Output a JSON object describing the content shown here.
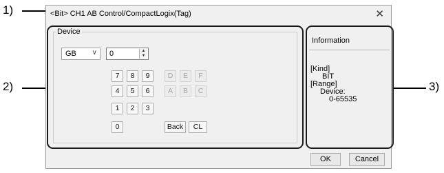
{
  "callouts": {
    "one": "1)",
    "two": "2)",
    "three": "3)"
  },
  "dialog": {
    "title": "<Bit> CH1 AB Control/CompactLogix(Tag)",
    "close_icon": "close-icon"
  },
  "device_group": {
    "label": "Device",
    "device_type": "GB",
    "device_number": "0"
  },
  "keypad": {
    "row1": [
      "7",
      "8",
      "9",
      "D",
      "E",
      "F"
    ],
    "row2": [
      "4",
      "5",
      "6",
      "A",
      "B",
      "C"
    ],
    "row3": [
      "1",
      "2",
      "3"
    ],
    "row4_zero": "0",
    "back": "Back",
    "clear": "CL"
  },
  "information": {
    "title": "Information",
    "kind_label": "[Kind]",
    "kind_value": "BIT",
    "range_label": "[Range]",
    "range_device_label": "Device:",
    "range_device_value": "0-65535"
  },
  "footer": {
    "ok": "OK",
    "cancel": "Cancel"
  }
}
